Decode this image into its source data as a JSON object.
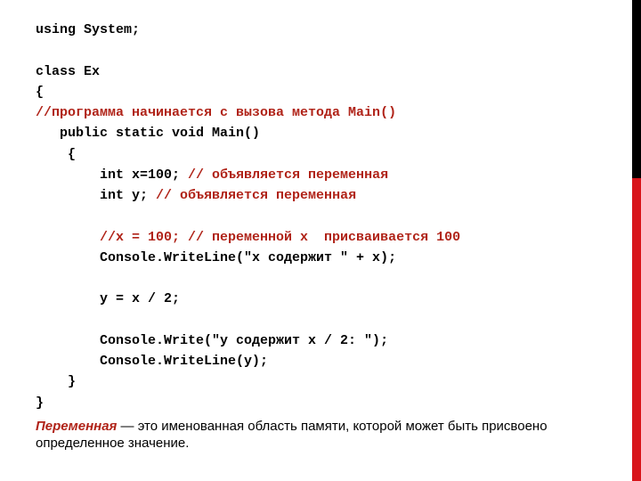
{
  "colors": {
    "comment": "#b02318",
    "accent_top": "#000000",
    "accent_bottom": "#d8141a"
  },
  "code": {
    "l1": "using System;",
    "l2": "class Ex",
    "l3": "{",
    "l4": "//программа начинается с вызова метода Main()",
    "l5": "   public static void Main()",
    "l6": "    {",
    "l7a": "        int x=100; ",
    "l7b": "// объявляется переменная",
    "l8a": "        int y; ",
    "l8b": "// объявляется переменная",
    "l9": "        //x = 100; // переменной x  присваивается 100",
    "l10": "        Console.WriteLine(\"x содержит \" + x);",
    "l11": "        y = x / 2;",
    "l12": "        Console.Write(\"y содержит x / 2: \");",
    "l13": "        Console.WriteLine(y);",
    "l14": "    }",
    "l15": "}"
  },
  "note": {
    "term": "Переменная",
    "text": " — это именованная область памяти, которой может быть присвоено определенное значение."
  }
}
